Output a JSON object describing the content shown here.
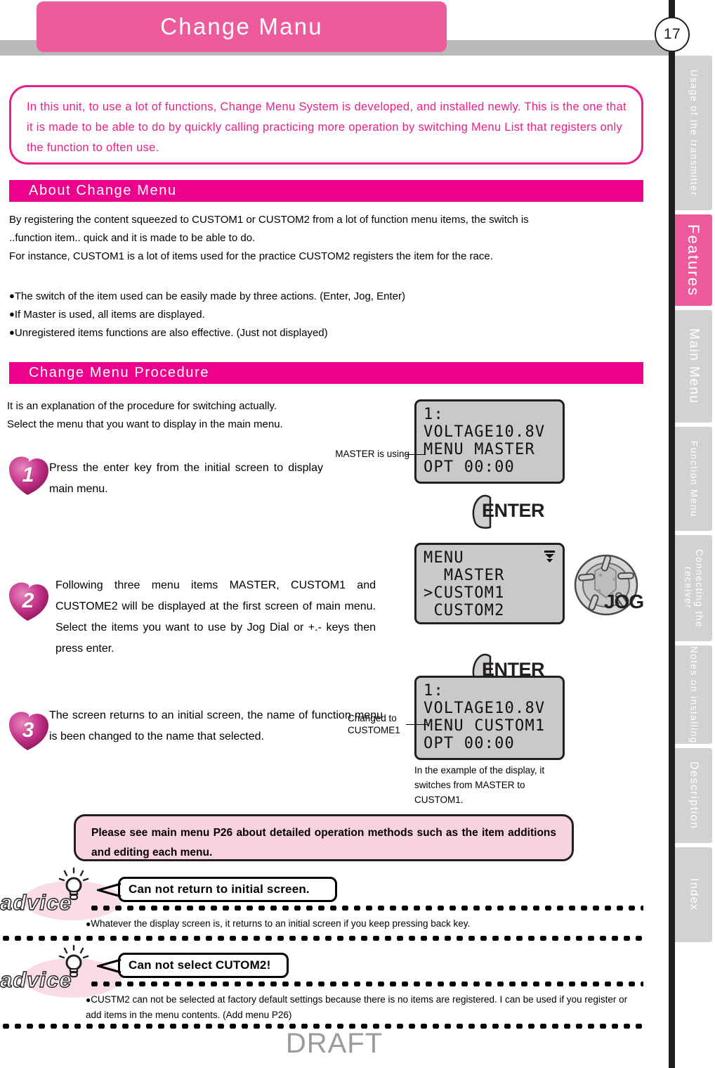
{
  "header": {
    "title": "Change Manu",
    "page_number": "17",
    "title_bg": "#ee5b9d",
    "band_color": "#b9b9b9"
  },
  "sidebar": {
    "tabs": [
      {
        "label": "Usage of the\ntransmitter",
        "active": false
      },
      {
        "label": "Features",
        "active": true
      },
      {
        "label": "Main Menu",
        "active": false
      },
      {
        "label": "Function Menu",
        "active": false
      },
      {
        "label": "Connecting\nthe receiver",
        "active": false
      },
      {
        "label": "Notes on\ninstalling",
        "active": false
      },
      {
        "label": "Description",
        "active": false
      },
      {
        "label": "Index",
        "active": false
      }
    ],
    "active_color": "#ee5b9d",
    "inactive_color": "#d2d2d2"
  },
  "intro": {
    "text": "In this unit, to use a lot of functions, Change Menu System is developed, and installed newly. This is the one that it is made to be able to do by quickly calling practicing more operation by switching  Menu List that registers only the function to often use.",
    "border_color": "#ec1e87",
    "text_color": "#ec1e87"
  },
  "section1": {
    "heading": "About Change Menu",
    "bar_color": "#ec008c",
    "para1": "By registering the content squeezed to CUSTOM1 or CUSTOM2 from a lot of function menu items, the switch is",
    "para2": "..function item.. quick and it is made to be able to do.",
    "para3": "For instance, CUSTOM1 is a lot of items used for the practice CUSTOM2 registers the item for the race.",
    "bullets": [
      "The switch of the item used can be easily made by three actions. (Enter, Jog, Enter)",
      "If Master is used, all items are displayed.",
      "Unregistered items functions are also effective. (Just not displayed)"
    ]
  },
  "section2": {
    "heading": "Change Menu Procedure",
    "bar_color": "#ec008c",
    "lead1": "It is an explanation of the procedure for switching actually.",
    "lead2": "Select the menu that you want to display in the main menu.",
    "steps": [
      {
        "number": "1",
        "text": "Press the enter key from the initial screen to display main menu."
      },
      {
        "number": "2",
        "text": "Following three menu items MASTER, CUSTOM1 and CUSTOME2 will be displayed at the first screen of main menu. Select the items you want to use by Jog Dial or +.- keys then press enter."
      },
      {
        "number": "3",
        "text": "The screen returns to an initial screen, the name of function menu is been changed to the name that selected."
      }
    ]
  },
  "lcd1": {
    "lines": [
      "1:",
      "VOLTAGE10.8V",
      "MENU MASTER",
      "OPT 00:00"
    ],
    "callout": "MASTER is using"
  },
  "lcd2": {
    "lines": [
      "MENU",
      "  MASTER",
      ">CUSTOM1",
      " CUSTOM2"
    ],
    "scroll_indicator": "down-arrow"
  },
  "lcd3": {
    "lines": [
      "1:",
      "VOLTAGE10.8V",
      "MENU CUSTOM1",
      "OPT 00:00"
    ],
    "callout": "Changed to\nCUSTOME1",
    "caption": "In the example of the display, it switches from MASTER to CUSTOM1."
  },
  "keys": {
    "enter_label": "ENTER",
    "jog_label": "JOG"
  },
  "notebox": {
    "text": "Please see main menu P26 about detailed operation methods such as the item additions and editing each menu.",
    "bg": "#f8d2e1"
  },
  "advice": [
    {
      "word": "advice",
      "bubble": "Can not return to initial screen.",
      "note": "Whatever the display screen is, it returns to an initial screen if you keep pressing back key."
    },
    {
      "word": "advice",
      "bubble": "Can not select CUTOM2!",
      "note": "CUSTM2 can not be selected at factory default settings because there is no items are registered. I can be used if you register or add items in the menu contents. (Add menu P26)"
    }
  ],
  "watermark": "DRAFT"
}
